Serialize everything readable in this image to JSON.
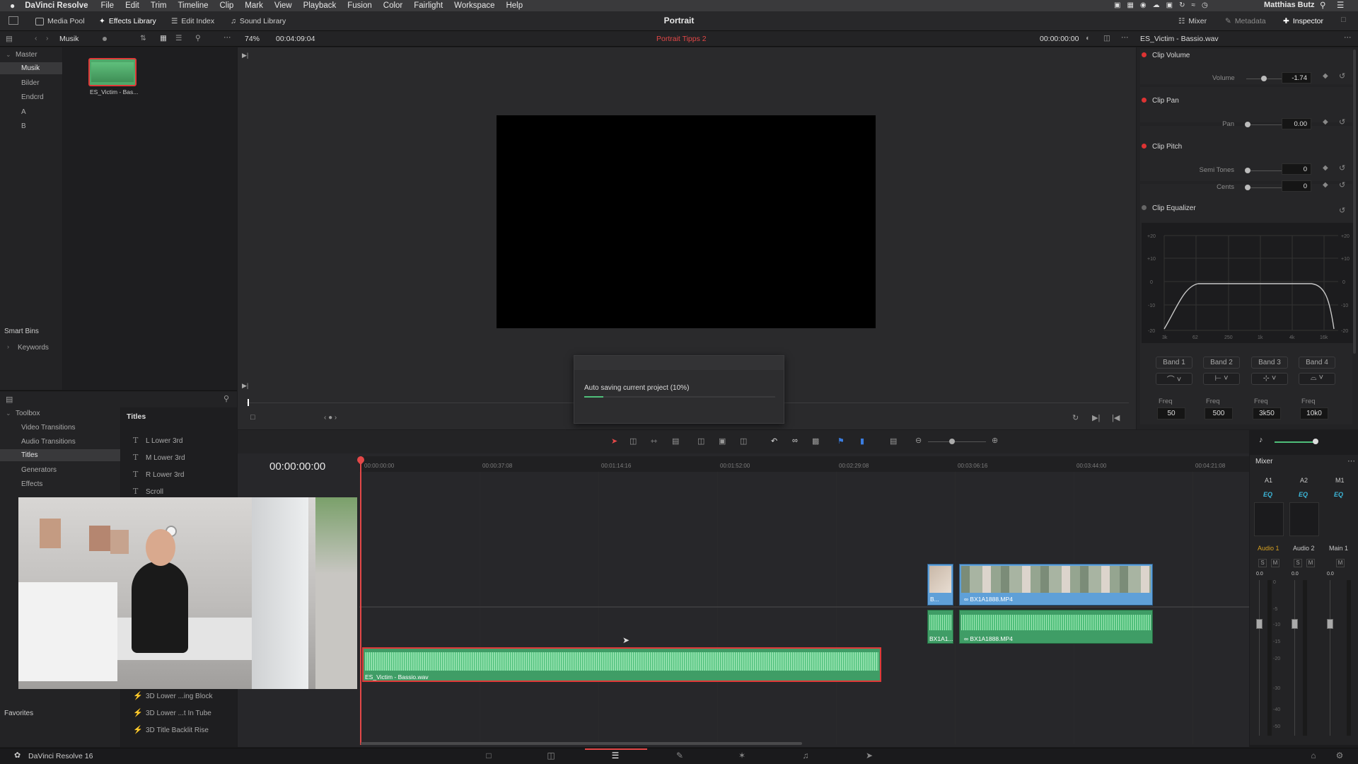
{
  "menubar": {
    "app_name": "DaVinci Resolve",
    "items": [
      "File",
      "Edit",
      "Trim",
      "Timeline",
      "Clip",
      "Mark",
      "View",
      "Playback",
      "Fusion",
      "Color",
      "Fairlight",
      "Workspace",
      "Help"
    ],
    "user": "Matthias Butz"
  },
  "toolbar": {
    "media_pool": "Media Pool",
    "effects_library": "Effects Library",
    "edit_index": "Edit Index",
    "sound_library": "Sound Library",
    "project_title": "Portrait",
    "mixer": "Mixer",
    "metadata": "Metadata",
    "inspector": "Inspector"
  },
  "subbar": {
    "bin_name": "Musik",
    "zoom": "74%",
    "duration": "00:04:09:04",
    "timeline_name": "Portrait Tipps 2",
    "timecode": "00:00:00:00",
    "inspector_clip": "ES_Victim - Bassio.wav"
  },
  "media_pool": {
    "bins": [
      "Master",
      "Musik",
      "Bilder",
      "Endcrd",
      "A",
      "B"
    ],
    "smart_bins_label": "Smart Bins",
    "keywords_label": "Keywords",
    "clip_name": "ES_Victim - Bas..."
  },
  "effects": {
    "toolbox_label": "Toolbox",
    "categories": [
      "Video Transitions",
      "Audio Transitions",
      "Titles",
      "Generators",
      "Effects"
    ],
    "favorites_label": "Favorites",
    "titles_header": "Titles",
    "titles": [
      "L Lower 3rd",
      "M Lower 3rd",
      "R Lower 3rd",
      "Scroll"
    ],
    "fusion_titles": [
      "3D Lower ...ing Block",
      "3D Lower ...t In Tube",
      "3D Title Backlit Rise"
    ]
  },
  "viewer": {
    "autosave_text": "Auto saving current project  (10%)",
    "autosave_progress": 0.1
  },
  "inspector": {
    "clip_volume": "Clip Volume",
    "volume_label": "Volume",
    "volume_value": "-1.74",
    "clip_pan": "Clip Pan",
    "pan_label": "Pan",
    "pan_value": "0.00",
    "clip_pitch": "Clip Pitch",
    "semitones_label": "Semi Tones",
    "semitones_value": "0",
    "cents_label": "Cents",
    "cents_value": "0",
    "clip_eq": "Clip Equalizer",
    "eq_y_labels": [
      "+20",
      "+10",
      "0",
      "-10",
      "-20"
    ],
    "eq_x_labels": [
      "3k",
      "62",
      "250",
      "1k",
      "4k",
      "16k"
    ],
    "bands": [
      "Band 1",
      "Band 2",
      "Band 3",
      "Band 4"
    ],
    "freq_label": "Freq",
    "freq_values": [
      "50",
      "500",
      "3k50",
      "10k0"
    ]
  },
  "timeline": {
    "timecode": "00:00:00:00",
    "ruler": [
      "00:00:00:00",
      "00:00:37:08",
      "00:01:14:16",
      "00:01:52:00",
      "00:02:29:08",
      "00:03:06:16",
      "00:03:44:00",
      "00:04:21:08"
    ],
    "video_clip_short": "B...",
    "video_clip": "BX1A1888.MP4",
    "audio_clip_short": "BX1A1...",
    "audio_clip": "BX1A1888.MP4",
    "music_clip": "ES_Victim - Bassio.wav"
  },
  "mixer": {
    "title": "Mixer",
    "channels": [
      "A1",
      "A2",
      "M1"
    ],
    "eq_label": "EQ",
    "tracks": [
      "Audio 1",
      "Audio 2",
      "Main 1"
    ],
    "solo": "S",
    "mute": "M",
    "level": "0.0",
    "scale": [
      "0",
      "-5",
      "-10",
      "-15",
      "-20",
      "-30",
      "-40",
      "-50"
    ]
  },
  "footer": {
    "app_version": "DaVinci Resolve 16"
  },
  "colors": {
    "accent_red": "#e34848",
    "clip_green": "#4fbf7a",
    "clip_blue": "#5fa0d8",
    "mixer_yellow": "#d6a020",
    "eq_cyan": "#3cb6d8"
  }
}
